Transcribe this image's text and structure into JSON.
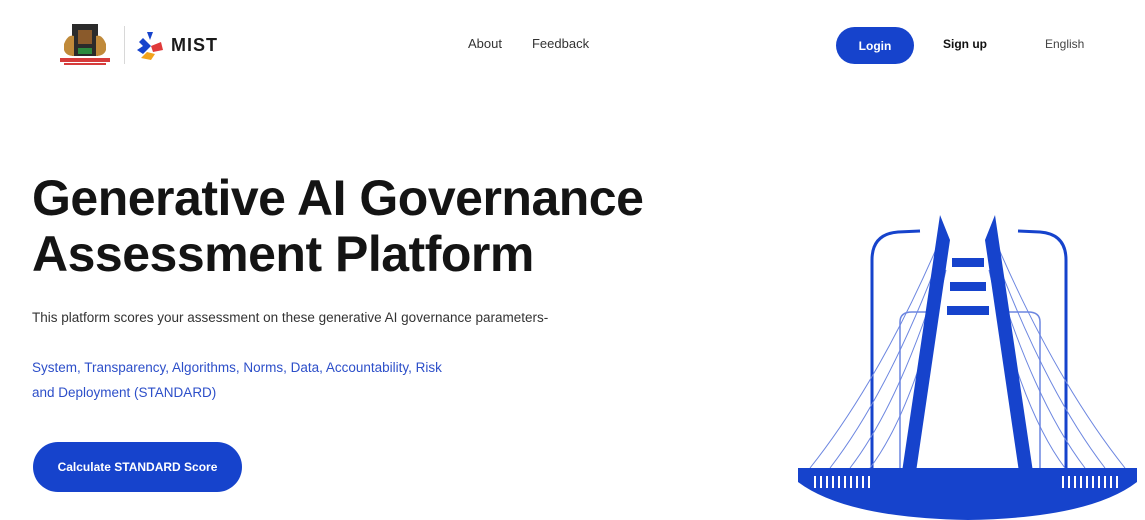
{
  "header": {
    "crest_logo": "lagos-state-crest",
    "brand_name": "MIST",
    "nav": [
      {
        "label": "About"
      },
      {
        "label": "Feedback"
      }
    ],
    "login_label": "Login",
    "signup_label": "Sign up",
    "language": "English"
  },
  "hero": {
    "title_line1": "Generative AI Governance",
    "title_line2": "Assessment Platform",
    "description": "This platform scores your assessment on these generative AI governance parameters-",
    "parameters_line1": "System, Transparency, Algorithms, Norms, Data, Accountability, Risk",
    "parameters_line2": "and Deployment (STANDARD)",
    "cta_label": "Calculate STANDARD Score"
  },
  "colors": {
    "primary": "#1643cc",
    "accent_text": "#2d4fc9",
    "heading": "#141414"
  },
  "icons": {
    "crest": "crest-icon",
    "mist_mark": "mist-logo-icon",
    "illustration": "cable-bridge-illustration"
  }
}
